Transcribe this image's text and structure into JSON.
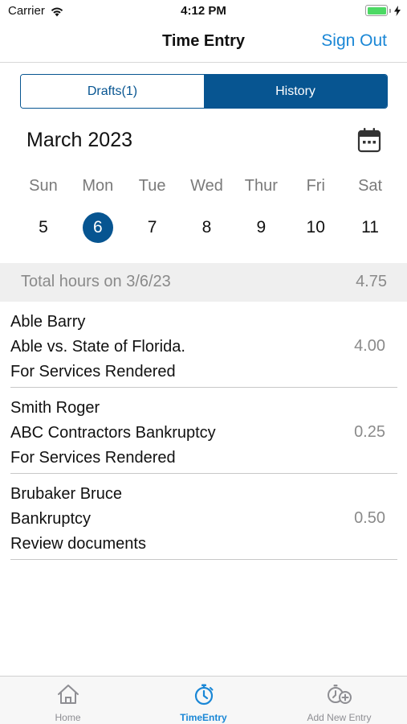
{
  "status_bar": {
    "carrier": "Carrier",
    "time": "4:12 PM",
    "battery_level": 1.0,
    "battery_color": "#4cd964"
  },
  "nav": {
    "title": "Time Entry",
    "sign_out_label": "Sign Out"
  },
  "segments": {
    "drafts_label": "Drafts(1)",
    "history_label": "History",
    "selected": "History"
  },
  "calendar": {
    "month_label": "March 2023",
    "icon": "calendar-icon",
    "weekdays": [
      "Sun",
      "Mon",
      "Tue",
      "Wed",
      "Thur",
      "Fri",
      "Sat"
    ],
    "dates": [
      "5",
      "6",
      "7",
      "8",
      "9",
      "10",
      "11"
    ],
    "selected_date": "6"
  },
  "summary": {
    "total_label": "Total hours on 3/6/23",
    "total_value": "4.75"
  },
  "entries": [
    {
      "client": "Able Barry",
      "matter": "Able vs. State of Florida.",
      "description": "For Services Rendered",
      "hours": "4.00"
    },
    {
      "client": "Smith Roger",
      "matter": "ABC Contractors Bankruptcy",
      "description": "For Services Rendered",
      "hours": "0.25"
    },
    {
      "client": "Brubaker Bruce",
      "matter": "Bankruptcy",
      "description": "Review documents",
      "hours": "0.50"
    }
  ],
  "tabs": [
    {
      "label": "Home",
      "icon": "home-icon"
    },
    {
      "label": "TimeEntry",
      "icon": "stopwatch-icon"
    },
    {
      "label": "Add New Entry",
      "icon": "add-timer-icon"
    }
  ],
  "colors": {
    "primary": "#075591",
    "accent": "#1a87d6",
    "inactive_tab": "#8e8e93"
  }
}
